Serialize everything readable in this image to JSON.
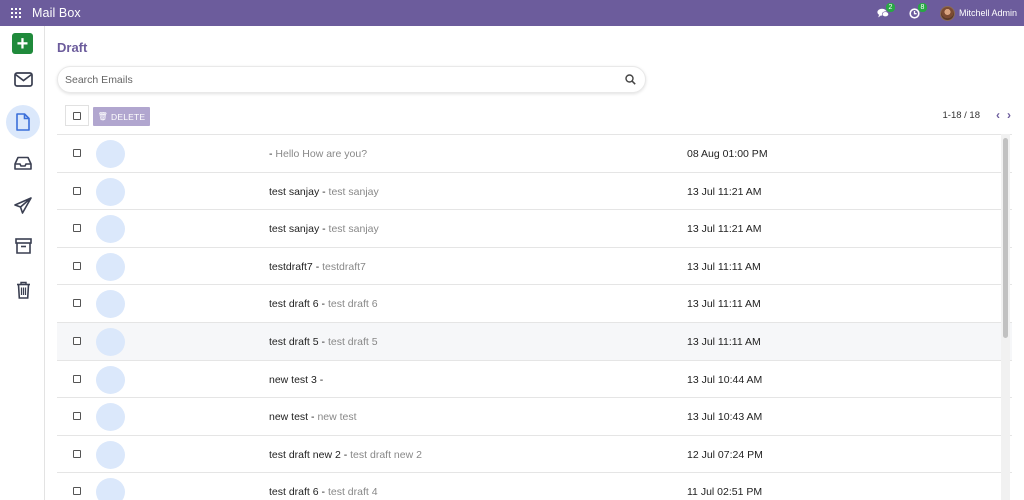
{
  "app": {
    "title": "Mail Box"
  },
  "topbar": {
    "messages_badge": "2",
    "activity_badge": "8",
    "user_name": "Mitchell Admin"
  },
  "sidebar": {
    "items": [
      {
        "name": "compose",
        "icon": "plus-icon"
      },
      {
        "name": "inbox",
        "icon": "envelope-icon"
      },
      {
        "name": "drafts",
        "icon": "file-icon",
        "active": true
      },
      {
        "name": "received",
        "icon": "inbox-tray-icon"
      },
      {
        "name": "sent",
        "icon": "paper-plane-icon"
      },
      {
        "name": "archive",
        "icon": "archive-icon"
      },
      {
        "name": "trash",
        "icon": "trash-icon"
      }
    ]
  },
  "page": {
    "title": "Draft"
  },
  "search": {
    "placeholder": "Search Emails",
    "value": ""
  },
  "toolbar": {
    "delete_label": "DELETE"
  },
  "pager": {
    "text": "1-18 / 18"
  },
  "emails": [
    {
      "subject": "",
      "preview": "Hello How are you?",
      "date": "08 Aug 01:00 PM"
    },
    {
      "subject": "test sanjay",
      "preview": "test sanjay",
      "date": "13 Jul 11:21 AM"
    },
    {
      "subject": "test sanjay",
      "preview": "test sanjay",
      "date": "13 Jul 11:21 AM"
    },
    {
      "subject": "testdraft7",
      "preview": "testdraft7",
      "date": "13 Jul 11:11 AM"
    },
    {
      "subject": "test draft 6",
      "preview": "test draft 6",
      "date": "13 Jul 11:11 AM"
    },
    {
      "subject": "test draft 5",
      "preview": "test draft 5",
      "date": "13 Jul 11:11 AM"
    },
    {
      "subject": "new test 3",
      "preview": "",
      "date": "13 Jul 10:44 AM"
    },
    {
      "subject": "new test",
      "preview": "new test",
      "date": "13 Jul 10:43 AM"
    },
    {
      "subject": "test draft new 2",
      "preview": "test draft new 2",
      "date": "12 Jul 07:24 PM"
    },
    {
      "subject": "test draft 6",
      "preview": "test draft 4",
      "date": "11 Jul 02:51 PM"
    }
  ],
  "colors": {
    "brand": "#6c5c9c",
    "compose": "#1f8a3b",
    "active_bg": "#dbe8fb",
    "badge": "#28a745"
  }
}
